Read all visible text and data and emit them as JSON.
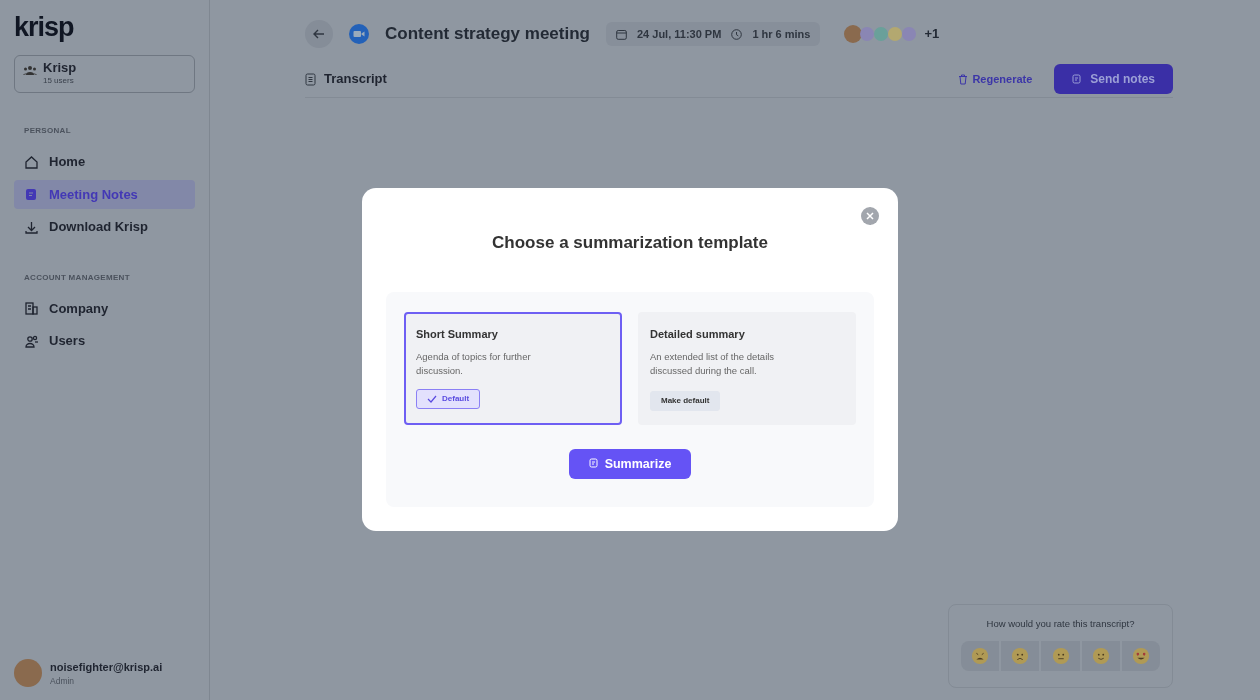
{
  "sidebar": {
    "logo": "krisp",
    "workspace": {
      "name": "Krisp",
      "members": "15 users"
    },
    "sections": [
      {
        "heading": "PERSONAL",
        "items": [
          {
            "kind": "home",
            "label": "Home",
            "selected": false
          },
          {
            "kind": "notes",
            "label": "Meeting Notes",
            "selected": true
          },
          {
            "kind": "download",
            "label": "Download Krisp",
            "selected": false
          }
        ]
      },
      {
        "heading": "ACCOUNT MANAGEMENT",
        "items": [
          {
            "kind": "company",
            "label": "Company",
            "selected": false
          },
          {
            "kind": "users",
            "label": "Users",
            "selected": false
          }
        ]
      }
    ],
    "user": {
      "email": "noisefighter@krisp.ai",
      "role": "Admin"
    }
  },
  "header": {
    "title": "Content strategy meeting",
    "date": "24 Jul, 11:30 PM",
    "duration": "1 hr 6 mins",
    "extra_participants": "+1"
  },
  "tabs": [
    {
      "label": "Transcript",
      "selected": true
    }
  ],
  "actions": {
    "regenerate": "Regenerate",
    "send": "Send notes"
  },
  "dialog": {
    "title": "Choose a summarization template",
    "templates": [
      {
        "title": "Short Summary",
        "description": "Agenda of topics for further discussion.",
        "selected": true,
        "is_default": true,
        "action": "Default"
      },
      {
        "title": "Detailed summary",
        "description": "An extended list of the details discussed during the call.",
        "selected": false,
        "is_default": false,
        "action": "Make default"
      }
    ],
    "submit": "Summarize"
  },
  "rating": {
    "question": "How would you rate this transcript?",
    "options": [
      {
        "kind": "weary"
      },
      {
        "kind": "frowning"
      },
      {
        "kind": "neutral"
      },
      {
        "kind": "smiling"
      },
      {
        "kind": "heart-eyes"
      }
    ]
  }
}
